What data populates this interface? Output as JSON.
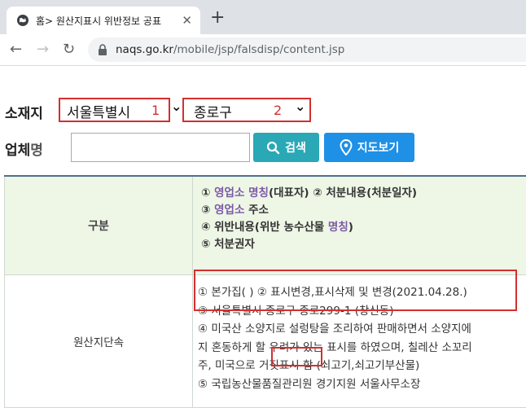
{
  "browser": {
    "tab_title": "홈> 원산지표시 위반정보 공표",
    "tab_close": "✕",
    "new_tab": "+",
    "url_host": "naqs.go.kr",
    "url_path": "/mobile/jsp/falsdisp/content.jsp",
    "back": "←",
    "forward": "→",
    "reload": "↻"
  },
  "form": {
    "location_label": "소재지",
    "city_value": "서울특별시",
    "city_marker": "1",
    "district_value": "종로구",
    "district_marker": "2",
    "chevron": "⌄",
    "business_label_a": "업체",
    "business_label_b": "명",
    "business_value": "",
    "search_label": "검색",
    "map_label": "지도보기"
  },
  "table": {
    "header_label": "구분",
    "header_lines": [
      {
        "a": "① ",
        "hl1": "영업소 명칭",
        "b": "(대표자) ② 처분내용(처분일자)"
      },
      {
        "a": "③ ",
        "hl1": "영업소",
        "b": " 주소"
      },
      {
        "a": "④ 위반내용(위반 농수산물 ",
        "hl1": "명칭",
        "b": ")"
      },
      {
        "a": "⑤ 처분권자",
        "hl1": "",
        "b": ""
      }
    ],
    "row_label": "원산지단속",
    "row_lines": [
      "① 본가집( ) ② 표시변경,표시삭제 및 변경(2021.04.28.)",
      "③ 서울특별시 종로구 종로299-1 (창신동)",
      "④ 미국산 소양지로 설렁탕을 조리하여 판매하면서 소양지에",
      "지 혼동하게 할 우려가 있는 표시를 하였으며, 칠레산 소꼬리",
      "주, 미국으로 거짓표시 함 (쇠고기,쇠고기부산물)",
      "⑤ 국립농산물품질관리원 경기지원 서울사무소장"
    ]
  },
  "colors": {
    "annotation_red": "#d32f2f",
    "search_button": "#2aa8b5",
    "map_button": "#1e90e6",
    "header_bg": "#eef6e6"
  }
}
